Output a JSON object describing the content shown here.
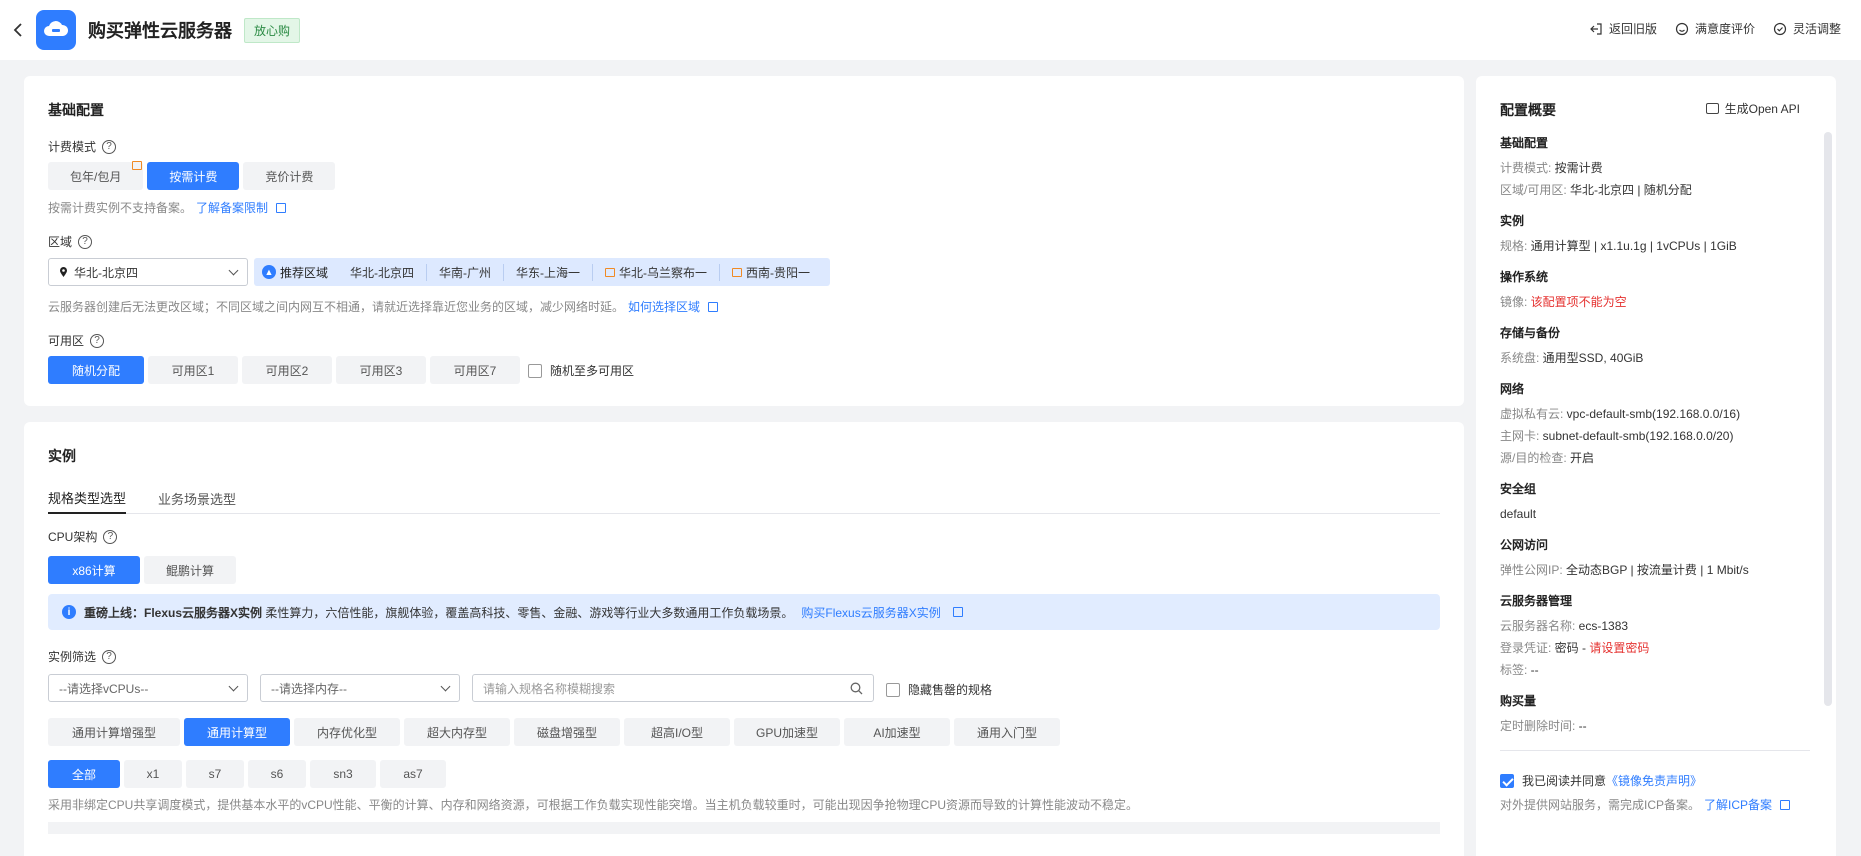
{
  "header": {
    "title": "购买弹性云服务器",
    "badge": "放心购",
    "actions": [
      {
        "label": "返回旧版",
        "icon": "back-to-old-icon"
      },
      {
        "label": "满意度评价",
        "icon": "smile-icon"
      },
      {
        "label": "灵活调整",
        "icon": "check-circle-icon"
      }
    ]
  },
  "basic": {
    "title": "基础配置",
    "billing": {
      "label": "计费模式",
      "options": [
        "包年/包月",
        "按需计费",
        "竞价计费"
      ],
      "selected": "按需计费",
      "tip": "按需计费实例不支持备案。",
      "tip_link": "了解备案限制"
    },
    "region": {
      "label": "区域",
      "selected": "华北-北京四",
      "recommend_label": "推荐区域",
      "recommended": [
        "华北-北京四",
        "华南-广州",
        "华东-上海一",
        "华北-乌兰察布一",
        "西南-贵阳一"
      ],
      "tip": "云服务器创建后无法更改区域；不同区域之间内网互不相通，请就近选择靠近您业务的区域，减少网络时延。",
      "tip_link": "如何选择区域"
    },
    "az": {
      "label": "可用区",
      "options": [
        "随机分配",
        "可用区1",
        "可用区2",
        "可用区3",
        "可用区7"
      ],
      "selected": "随机分配",
      "random_multi": "随机至多可用区"
    }
  },
  "instance": {
    "title": "实例",
    "tabs": [
      "规格类型选型",
      "业务场景选型"
    ],
    "cpu_arch": {
      "label": "CPU架构",
      "options": [
        "x86计算",
        "鲲鹏计算"
      ],
      "selected": "x86计算"
    },
    "banner": {
      "bold": "重磅上线：Flexus云服务器X实例",
      "text": " 柔性算力，六倍性能，旗舰体验，覆盖高科技、零售、金融、游戏等行业大多数通用工作负载场景。",
      "link": "购买Flexus云服务器X实例"
    },
    "filter": {
      "label": "实例筛选",
      "vcpu_placeholder": "--请选择vCPUs--",
      "mem_placeholder": "--请选择内存--",
      "search_placeholder": "请输入规格名称模糊搜索",
      "hide_soldout": "隐藏售罄的规格"
    },
    "types": [
      "通用计算增强型",
      "通用计算型",
      "内存优化型",
      "超大内存型",
      "磁盘增强型",
      "超高I/O型",
      "GPU加速型",
      "AI加速型",
      "通用入门型"
    ],
    "type_selected": "通用计算型",
    "series": [
      "全部",
      "x1",
      "s7",
      "s6",
      "sn3",
      "as7"
    ],
    "series_selected": "全部",
    "desc": "采用非绑定CPU共享调度模式，提供基本水平的vCPU性能、平衡的计算、内存和网络资源，可根据工作负载实现性能突增。当主机负载较重时，可能出现因争抢物理CPU资源而导致的计算性能波动不稳定。"
  },
  "summary": {
    "title": "配置概要",
    "openapi": "生成Open API",
    "groups": [
      {
        "h": "基础配置",
        "lines": [
          [
            "计费模式: ",
            "按需计费",
            ""
          ],
          [
            "区域/可用区: ",
            "华北-北京四 | 随机分配",
            ""
          ]
        ]
      },
      {
        "h": "实例",
        "lines": [
          [
            "规格: ",
            "通用计算型 | x1.1u.1g | 1vCPUs | 1GiB",
            ""
          ]
        ]
      },
      {
        "h": "操作系统",
        "lines": [
          [
            "镜像: ",
            "",
            "该配置项不能为空"
          ]
        ]
      },
      {
        "h": "存储与备份",
        "lines": [
          [
            "系统盘: ",
            "通用型SSD, 40GiB",
            ""
          ]
        ]
      },
      {
        "h": "网络",
        "lines": [
          [
            "虚拟私有云: ",
            "vpc-default-smb(192.168.0.0/16)",
            ""
          ],
          [
            "主网卡: ",
            "subnet-default-smb(192.168.0.0/20)",
            ""
          ],
          [
            "源/目的检查: ",
            "开启",
            ""
          ]
        ]
      },
      {
        "h": "安全组",
        "lines": [
          [
            "",
            "default",
            ""
          ]
        ]
      },
      {
        "h": "公网访问",
        "lines": [
          [
            "弹性公网IP: ",
            "全动态BGP | 按流量计费 | 1 Mbit/s",
            ""
          ]
        ]
      },
      {
        "h": "云服务器管理",
        "lines": [
          [
            "云服务器名称: ",
            "ecs-1383",
            ""
          ],
          [
            "登录凭证: ",
            "密码 - ",
            "请设置密码"
          ],
          [
            "标签: ",
            "--",
            ""
          ]
        ]
      },
      {
        "h": "购买量",
        "lines": [
          [
            "定时删除时间: ",
            "--",
            ""
          ]
        ]
      }
    ],
    "agree_prefix": "我已阅读并同意",
    "agree_link": "《镜像免责声明》",
    "icp_text": "对外提供网站服务，需完成ICP备案。",
    "icp_link": "了解ICP备案"
  },
  "colors": {
    "accent": "#2f7dff",
    "error": "#e5312f",
    "badge_bg": "#e3f6e7"
  }
}
